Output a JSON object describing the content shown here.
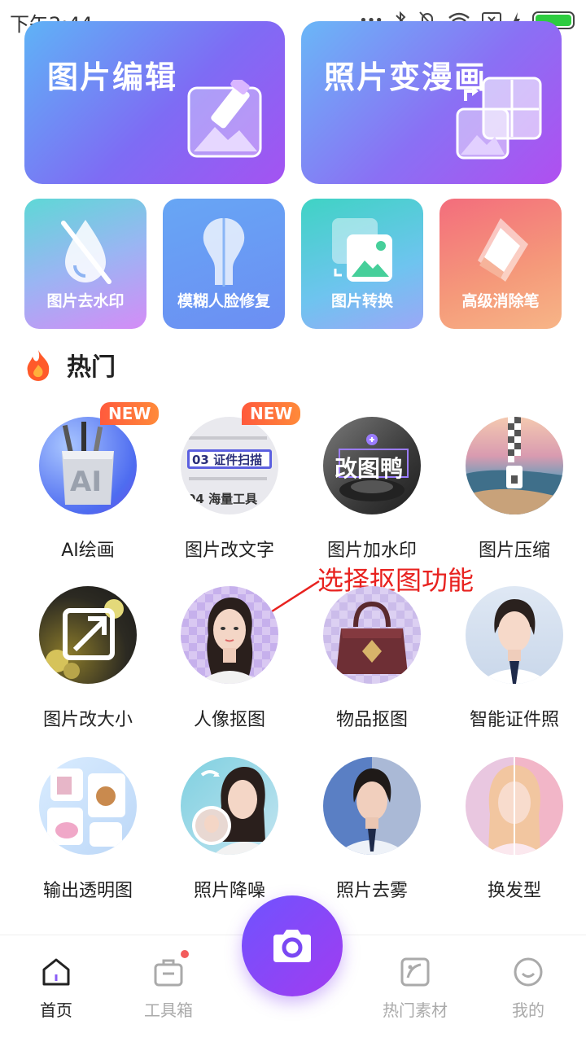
{
  "status_bar": {
    "time": "下午2:44",
    "dots": "•••"
  },
  "top_cards": [
    {
      "label": "图片编辑"
    },
    {
      "label": "照片变漫画"
    }
  ],
  "feature_cards": [
    {
      "label": "图片去水印"
    },
    {
      "label": "模糊人脸修复"
    },
    {
      "label": "图片转换"
    },
    {
      "label": "高级消除笔"
    }
  ],
  "hot_section": {
    "title": "热门",
    "badge": "NEW"
  },
  "tools": [
    {
      "label": "AI绘画",
      "badge": "NEW",
      "art_text": "AI"
    },
    {
      "label": "图片改文字",
      "badge": "NEW",
      "art_text": "03 证件扫描",
      "art_text2": "04 海量工具"
    },
    {
      "label": "图片加水印",
      "art_text": "改图鸭"
    },
    {
      "label": "图片压缩"
    },
    {
      "label": "图片改大小"
    },
    {
      "label": "人像抠图"
    },
    {
      "label": "物品抠图"
    },
    {
      "label": "智能证件照"
    },
    {
      "label": "输出透明图"
    },
    {
      "label": "照片降噪"
    },
    {
      "label": "照片去雾"
    },
    {
      "label": "换发型"
    }
  ],
  "annotation": {
    "text": "选择抠图功能"
  },
  "bottom_nav": [
    {
      "label": "首页"
    },
    {
      "label": "工具箱"
    },
    {
      "label": "热门素材"
    },
    {
      "label": "我的"
    }
  ],
  "colors": {
    "accent": "#7c4dff",
    "annotation": "#e8221f"
  }
}
